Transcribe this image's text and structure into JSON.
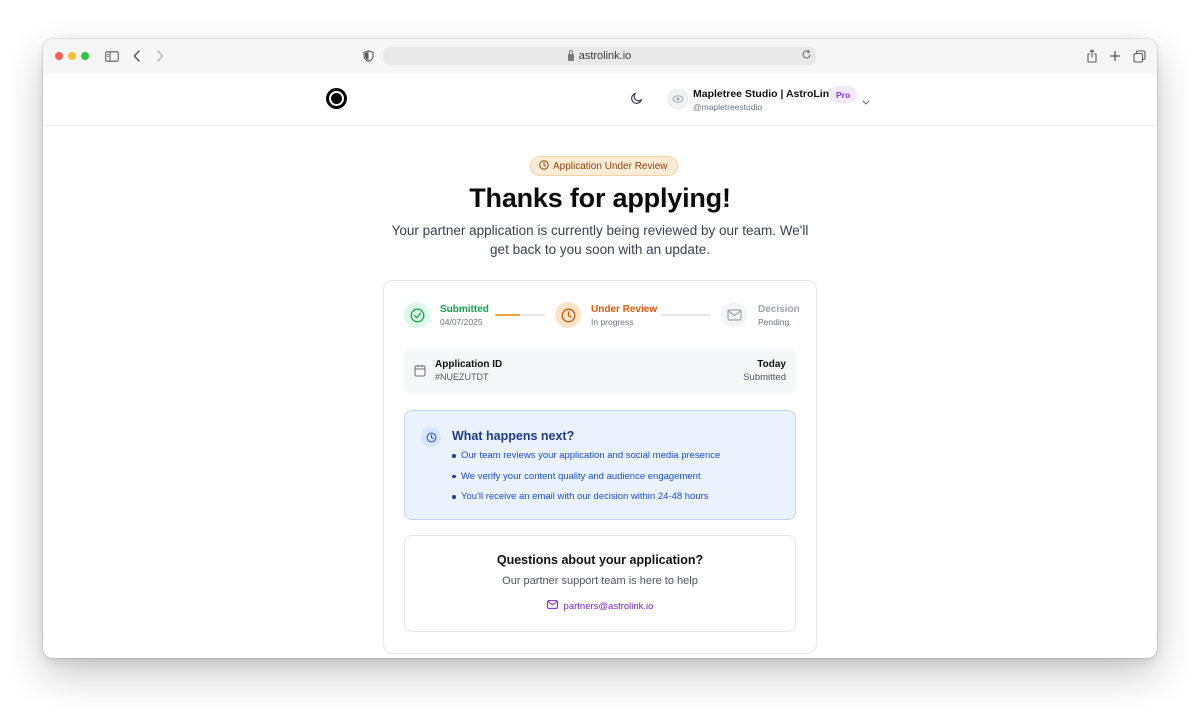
{
  "browser": {
    "url": "astrolink.io"
  },
  "header": {
    "account_name": "Mapletree Studio | AstroLink.io",
    "account_handle": "@mapletreestudio",
    "plan_badge": "Pro"
  },
  "status_badge": "Application Under Review",
  "title": "Thanks for applying!",
  "subtitle": "Your partner application is currently being reviewed by our team. We'll get back to you soon with an update.",
  "progress": {
    "steps": [
      {
        "label": "Submitted",
        "sub": "04/07/2025",
        "state": "complete",
        "color": "#16a34a"
      },
      {
        "label": "Under Review",
        "sub": "In progress",
        "state": "active",
        "color": "#ea580c"
      },
      {
        "label": "Decision",
        "sub": "Pending",
        "state": "pending",
        "color": "#9ca3af"
      }
    ],
    "connector_fill": [
      0.5,
      0
    ]
  },
  "application": {
    "id_label": "Application ID",
    "id_value": "#NUEZUTDT",
    "date": "Today",
    "status": "Submitted"
  },
  "next_steps": {
    "title": "What happens next?",
    "items": [
      "Our team reviews your application and social media presence",
      "We verify your content quality and audience engagement",
      "You'll receive an email with our decision within 24-48 hours"
    ]
  },
  "questions": {
    "title": "Questions about your application?",
    "subtitle": "Our partner support team is here to help",
    "email": "partners@astrolink.io"
  },
  "colors": {
    "accent_purple": "#7e22ce",
    "badge_bg": "#fcecd6",
    "info_bg": "#eaf2fd"
  }
}
